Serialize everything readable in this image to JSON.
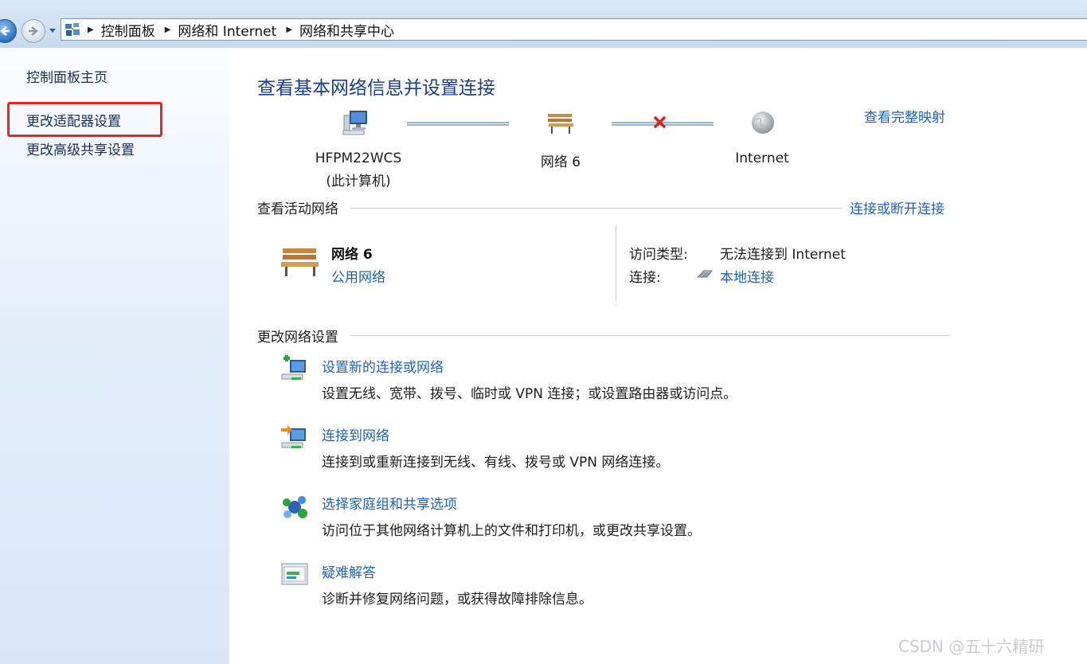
{
  "breadcrumb": [
    "控制面板",
    "网络和 Internet",
    "网络和共享中心"
  ],
  "left_nav": {
    "home": "控制面板主页",
    "adapter_settings": "更改适配器设置",
    "advanced_sharing": "更改高级共享设置"
  },
  "main": {
    "title": "查看基本网络信息并设置连接",
    "full_map_link": "查看完整映射",
    "map": {
      "computer_name": "HFPM22WCS",
      "computer_sub": "(此计算机)",
      "network_name": "网络  6",
      "internet_label": "Internet"
    },
    "active_networks": {
      "heading": "查看活动网络",
      "connect_link": "连接或断开连接",
      "network_name": "网络  6",
      "network_type": "公用网络",
      "access_type_label": "访问类型:",
      "access_type_value": "无法连接到 Internet",
      "connection_label": "连接:",
      "connection_value": "本地连接"
    },
    "change_settings": {
      "heading": "更改网络设置",
      "tasks": [
        {
          "title": "设置新的连接或网络",
          "desc": "设置无线、宽带、拨号、临时或 VPN 连接；或设置路由器或访问点。",
          "icon": "new-connection-icon"
        },
        {
          "title": "连接到网络",
          "desc": "连接到或重新连接到无线、有线、拨号或 VPN 网络连接。",
          "icon": "connect-network-icon"
        },
        {
          "title": "选择家庭组和共享选项",
          "desc": "访问位于其他网络计算机上的文件和打印机，或更改共享设置。",
          "icon": "homegroup-icon"
        },
        {
          "title": "疑难解答",
          "desc": "诊断并修复网络问题，或获得故障排除信息。",
          "icon": "troubleshoot-icon"
        }
      ]
    }
  },
  "watermark": "CSDN @五十六精研",
  "colors": {
    "link": "#1f63b8",
    "title": "#1c3d8c",
    "highlight": "#ee2323",
    "error_x": "#e0201c"
  }
}
